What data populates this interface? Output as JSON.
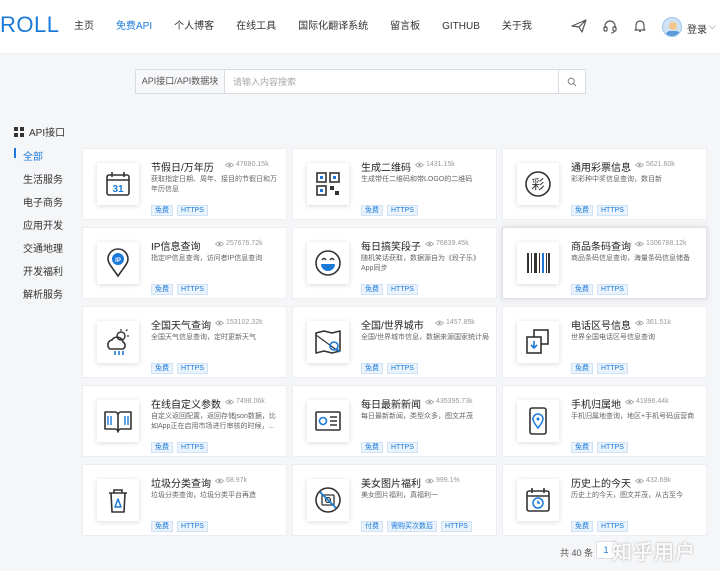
{
  "header": {
    "logo": "ROLL",
    "nav": [
      "主页",
      "免费API",
      "个人博客",
      "在线工具",
      "国际化翻译系统",
      "留言板",
      "GITHUB",
      "关于我"
    ],
    "active_nav": 1,
    "login": "登录"
  },
  "search": {
    "select": "API接口/API数据块",
    "placeholder": "请输入内容搜索"
  },
  "sidebar": {
    "title": "API接口",
    "items": [
      "全部",
      "生活服务",
      "电子商务",
      "应用开发",
      "交通地理",
      "开发福利",
      "解析服务"
    ]
  },
  "cards": [
    {
      "title": "节假日/万年历",
      "views": "47880.15k",
      "desc": "获取指定日期、周年、接目的节假日和万年历信息",
      "tags": [
        "免费",
        "HTTPS"
      ],
      "icon": "calendar-icon"
    },
    {
      "title": "生成二维码",
      "views": "1431.15k",
      "desc": "生成带任二维码和带LOGO的二维码",
      "tags": [
        "免费",
        "HTTPS"
      ],
      "icon": "qrcode-icon"
    },
    {
      "title": "通用彩票信息",
      "views": "5621.60k",
      "desc": "彩彩种中奖信息查询，数目新",
      "tags": [
        "免费",
        "HTTPS"
      ],
      "icon": "lottery-icon"
    },
    {
      "title": "IP信息查询",
      "views": "257676.72k",
      "desc": "指定IP信息查询，访问者IP信息查询",
      "tags": [
        "免费",
        "HTTPS"
      ],
      "icon": "ip-location-icon"
    },
    {
      "title": "每日搞笑段子",
      "views": "76839.45k",
      "desc": "随机笑话获取，数据源自为《段子乐》App同步",
      "tags": [
        "免费",
        "HTTPS"
      ],
      "icon": "laugh-face-icon"
    },
    {
      "title": "商品条码查询",
      "views": "1306788.12k",
      "desc": "商品条码信息查询，海量条码信息储备",
      "tags": [
        "免费",
        "HTTPS"
      ],
      "icon": "barcode-icon"
    },
    {
      "title": "全国天气查询",
      "views": "153102.32k",
      "desc": "全国天气信息查询，定时更新天气",
      "tags": [
        "免费",
        "HTTPS"
      ],
      "icon": "weather-icon"
    },
    {
      "title": "全国/世界城市",
      "views": "1457.85k",
      "desc": "全国/世界城市信息，数据来源国家统计局",
      "tags": [
        "免费",
        "HTTPS"
      ],
      "icon": "map-search-icon"
    },
    {
      "title": "电话区号信息",
      "views": "361.51k",
      "desc": "世界全国电话区号信息查询",
      "tags": [
        "免费",
        "HTTPS"
      ],
      "icon": "phone-area-icon"
    },
    {
      "title": "在线自定义参数",
      "views": "7498.06k",
      "desc": "自定义返回配置，返回存储json数据，比如App正在启用市场进行审核的时候，...",
      "tags": [
        "免费",
        "HTTPS"
      ],
      "icon": "book-icon"
    },
    {
      "title": "每日最新新闻",
      "views": "435395.73k",
      "desc": "每日最新新闻，类型众多，图文并茂",
      "tags": [
        "免费",
        "HTTPS"
      ],
      "icon": "news-icon"
    },
    {
      "title": "手机归属地",
      "views": "41896.44k",
      "desc": "手机归属地查询，地区+手机号码运营商",
      "tags": [
        "免费",
        "HTTPS"
      ],
      "icon": "mobile-location-icon"
    },
    {
      "title": "垃圾分类查询",
      "views": "68.97k",
      "desc": "垃圾分类查询，垃圾分类平台再造",
      "tags": [
        "免费",
        "HTTPS"
      ],
      "icon": "trash-recycle-icon"
    },
    {
      "title": "美女图片福利",
      "views": "999.1%",
      "desc": "美女图片福利，真福利一",
      "tags": [
        "付费",
        "需购买次数后",
        "HTTPS"
      ],
      "icon": "no-photo-icon"
    },
    {
      "title": "历史上的今天",
      "views": "432.69k",
      "desc": "历史上的今天，图文并茂，从古至今",
      "tags": [
        "免费",
        "HTTPS"
      ],
      "icon": "calendar-clock-icon"
    }
  ],
  "pagination": {
    "total": "共 40 条",
    "current": "1"
  },
  "watermark": "知乎用户"
}
